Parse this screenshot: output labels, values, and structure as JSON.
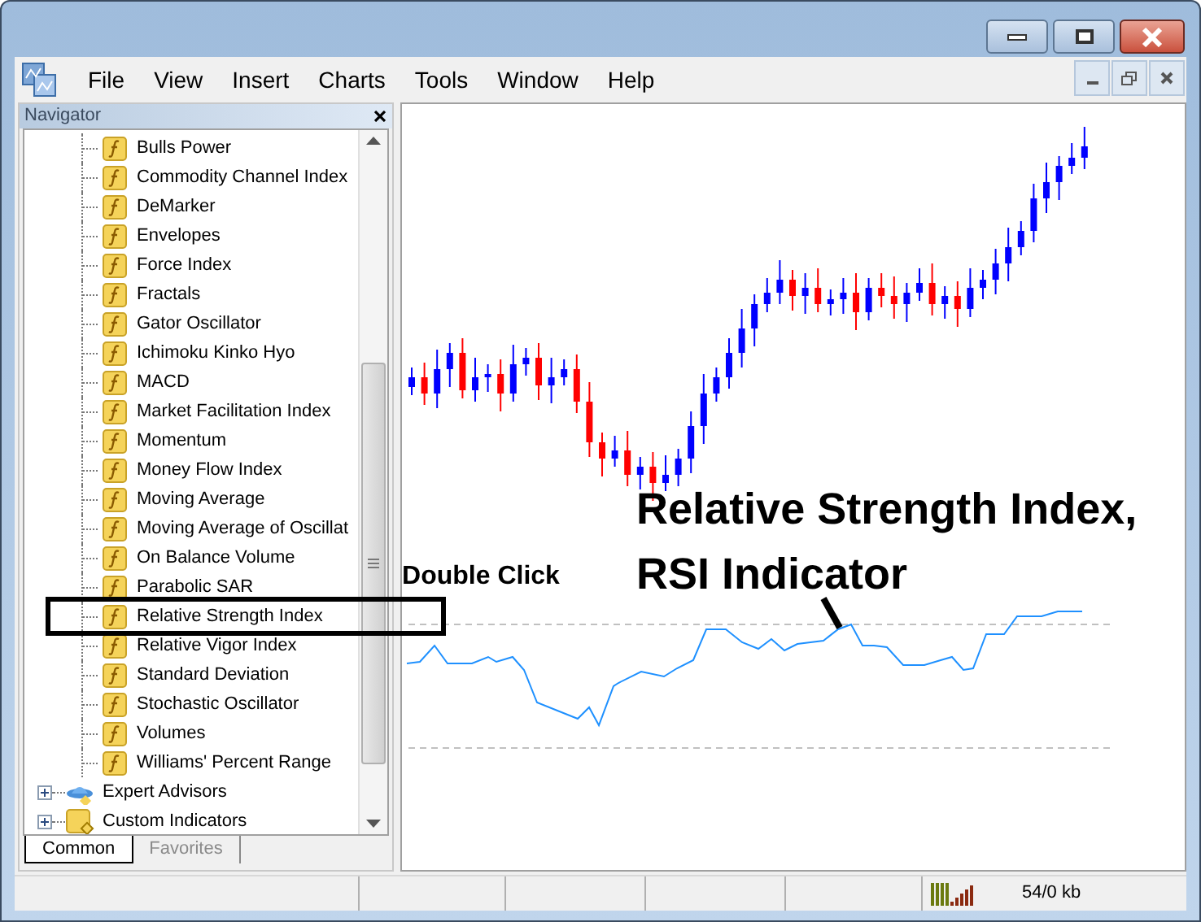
{
  "menu": [
    "File",
    "View",
    "Insert",
    "Charts",
    "Tools",
    "Window",
    "Help"
  ],
  "navigator": {
    "title": "Navigator",
    "indicators": [
      {
        "label": "Bulls Power",
        "highlighted": false
      },
      {
        "label": "Commodity Channel Index",
        "highlighted": false
      },
      {
        "label": "DeMarker",
        "highlighted": false
      },
      {
        "label": "Envelopes",
        "highlighted": false
      },
      {
        "label": "Force Index",
        "highlighted": false
      },
      {
        "label": "Fractals",
        "highlighted": false
      },
      {
        "label": "Gator Oscillator",
        "highlighted": false
      },
      {
        "label": "Ichimoku Kinko Hyo",
        "highlighted": false
      },
      {
        "label": "MACD",
        "highlighted": false
      },
      {
        "label": "Market Facilitation Index",
        "highlighted": false
      },
      {
        "label": "Momentum",
        "highlighted": false
      },
      {
        "label": "Money Flow Index",
        "highlighted": false
      },
      {
        "label": "Moving Average",
        "highlighted": false
      },
      {
        "label": "Moving Average of Oscillat",
        "highlighted": false
      },
      {
        "label": "On Balance Volume",
        "highlighted": false
      },
      {
        "label": "Parabolic SAR",
        "highlighted": false
      },
      {
        "label": "Relative Strength Index",
        "highlighted": true
      },
      {
        "label": "Relative Vigor Index",
        "highlighted": false
      },
      {
        "label": "Standard Deviation",
        "highlighted": false
      },
      {
        "label": "Stochastic Oscillator",
        "highlighted": false
      },
      {
        "label": "Volumes",
        "highlighted": false
      },
      {
        "label": "Williams' Percent Range",
        "highlighted": false
      }
    ],
    "folders": [
      {
        "label": "Expert Advisors",
        "kind": "experts",
        "expanded": false
      },
      {
        "label": "Custom Indicators",
        "kind": "custom",
        "expanded": false
      }
    ],
    "tabs": [
      {
        "label": "Common",
        "selected": true
      },
      {
        "label": "Favorites",
        "selected": false
      }
    ]
  },
  "chart": {
    "hint": "Double Click",
    "callout": [
      "Relative Strength Index,",
      "RSI Indicator"
    ]
  },
  "status_bar": {
    "traffic": "54/0 kb"
  }
}
